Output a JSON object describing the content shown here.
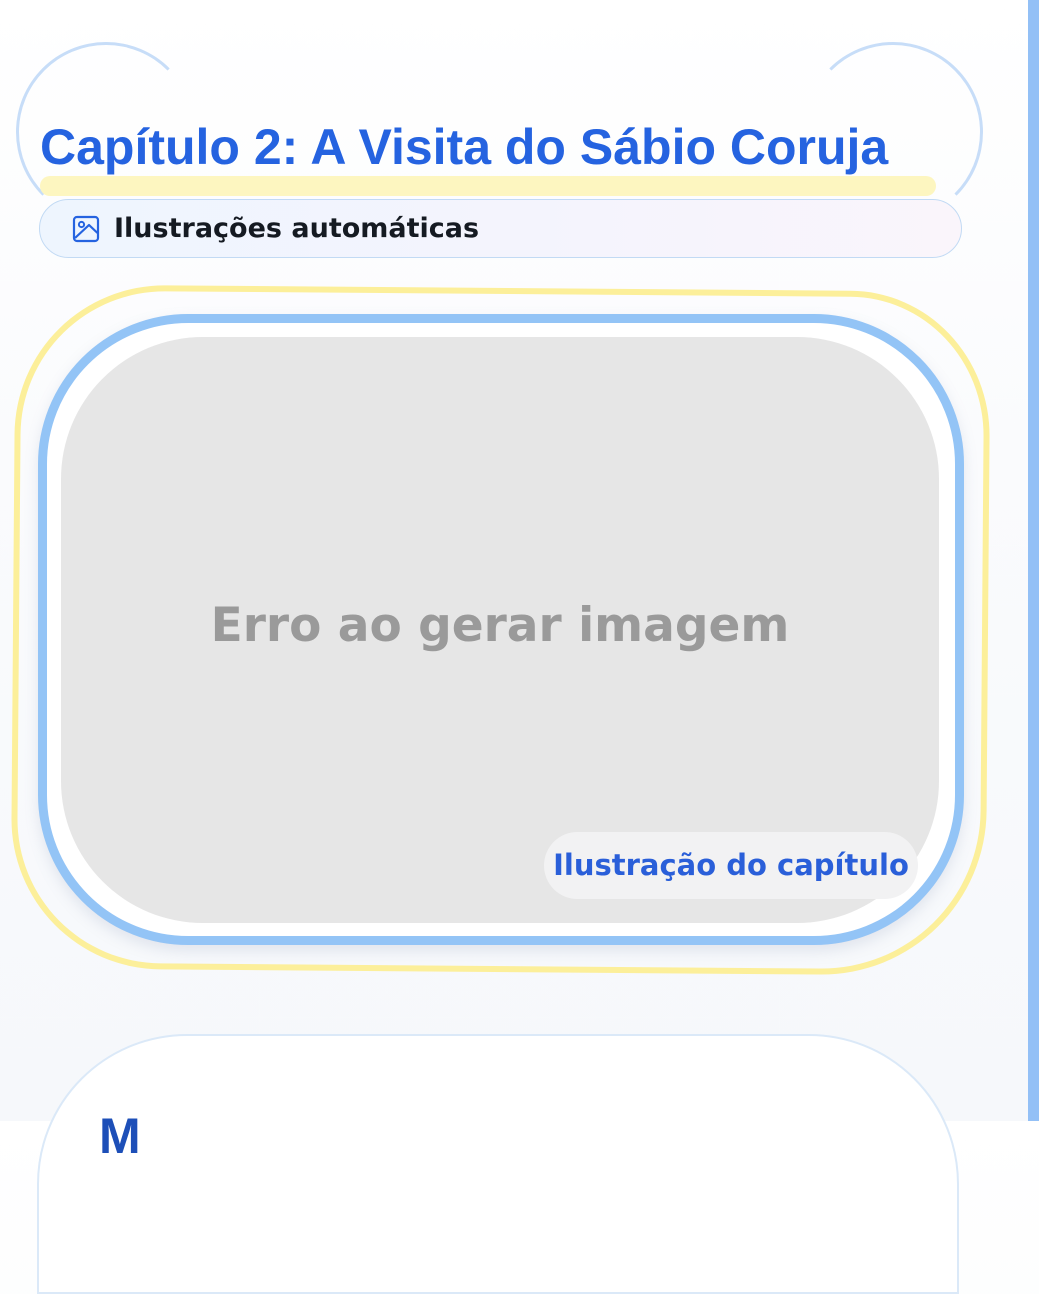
{
  "chapter": {
    "title": "Capítulo 2: A Visita do Sábio Coruja"
  },
  "auto_illustrations": {
    "label": "Ilustrações automáticas",
    "icon": "image-icon"
  },
  "illustration": {
    "error_text": "Erro ao gerar imagem",
    "caption": "Ilustração do capítulo"
  },
  "next_section": {
    "heading_partial": "M"
  },
  "colors": {
    "title_blue": "#2563e0",
    "frame_blue": "#93c4f6",
    "frame_yellow": "#fcef9a",
    "title_highlight": "#fdf6c0",
    "caption_text": "#2a5fd9",
    "error_text": "#9a9a9a",
    "placeholder_bg": "#e6e6e6"
  }
}
